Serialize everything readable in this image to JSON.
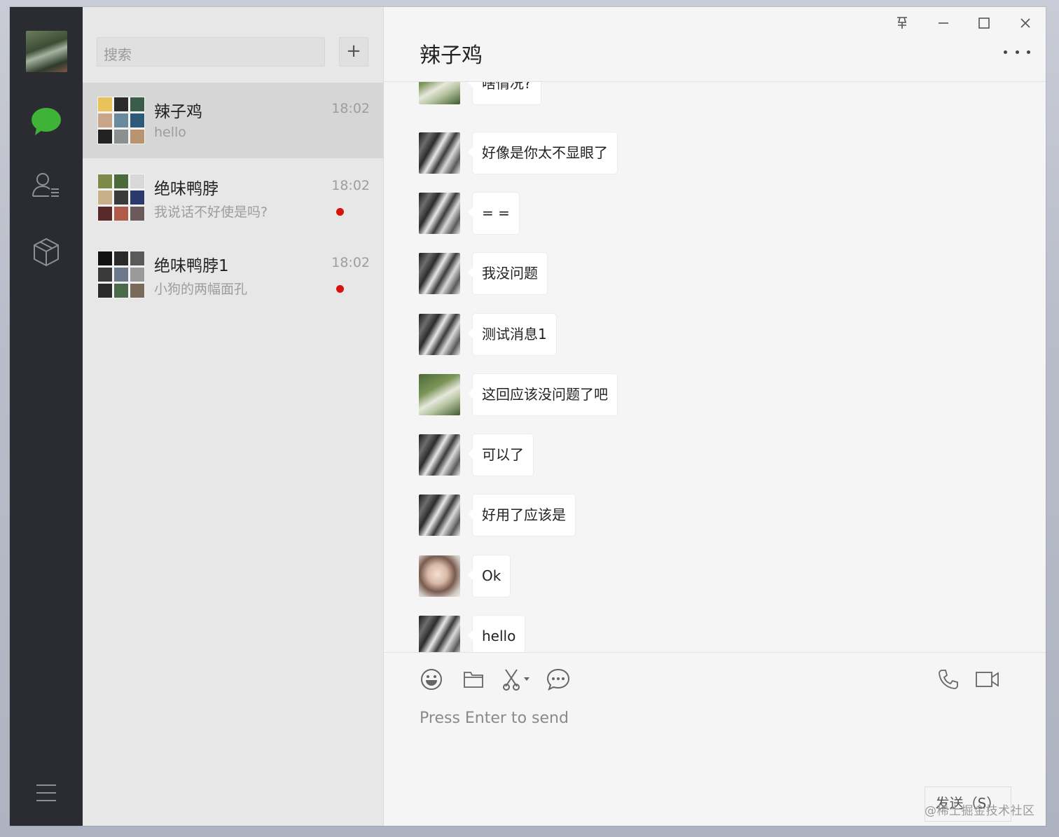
{
  "search": {
    "placeholder": "搜索",
    "add_label": "+"
  },
  "nav": {
    "items": [
      {
        "name": "chat",
        "icon": "chat-bubble-icon",
        "active": true
      },
      {
        "name": "contacts",
        "icon": "contacts-icon"
      },
      {
        "name": "collections",
        "icon": "box-icon"
      },
      {
        "name": "menu",
        "icon": "hamburger-menu-icon"
      }
    ]
  },
  "conversations": [
    {
      "name": "辣子鸡",
      "preview": "hello",
      "time": "18:02",
      "unread": false,
      "active": true
    },
    {
      "name": "绝味鸭脖",
      "preview": "我说话不好使是吗?",
      "time": "18:02",
      "unread": true
    },
    {
      "name": "绝味鸭脖1",
      "preview": "小狗的两幅面孔",
      "time": "18:02",
      "unread": true
    }
  ],
  "chat": {
    "title": "辣子鸡",
    "messages": [
      {
        "text": "啥情况?",
        "avatar": "green"
      },
      {
        "text": "好像是你太不显眼了",
        "avatar": "bw"
      },
      {
        "text": "= =",
        "avatar": "bw"
      },
      {
        "text": "我没问题",
        "avatar": "bw"
      },
      {
        "text": "测试消息1",
        "avatar": "bw"
      },
      {
        "text": "这回应该没问题了吧",
        "avatar": "green"
      },
      {
        "text": "可以了",
        "avatar": "bw"
      },
      {
        "text": "好用了应该是",
        "avatar": "bw"
      },
      {
        "text": "Ok",
        "avatar": "girl"
      },
      {
        "text": "hello",
        "avatar": "bw"
      }
    ]
  },
  "composer": {
    "placeholder": "Press Enter to send",
    "send_label": "发送（S）",
    "tools": [
      "emoji-icon",
      "folder-icon",
      "scissors-icon",
      "chat-history-icon",
      "phone-icon",
      "video-icon"
    ]
  },
  "window_controls": [
    "pin-icon",
    "minimize-icon",
    "maximize-icon",
    "close-icon"
  ],
  "watermark": "@稀土掘金技术社区",
  "colors": {
    "nav_bg": "#2a2c31",
    "accent_green": "#3fb238",
    "unread_dot": "#d8120d"
  }
}
